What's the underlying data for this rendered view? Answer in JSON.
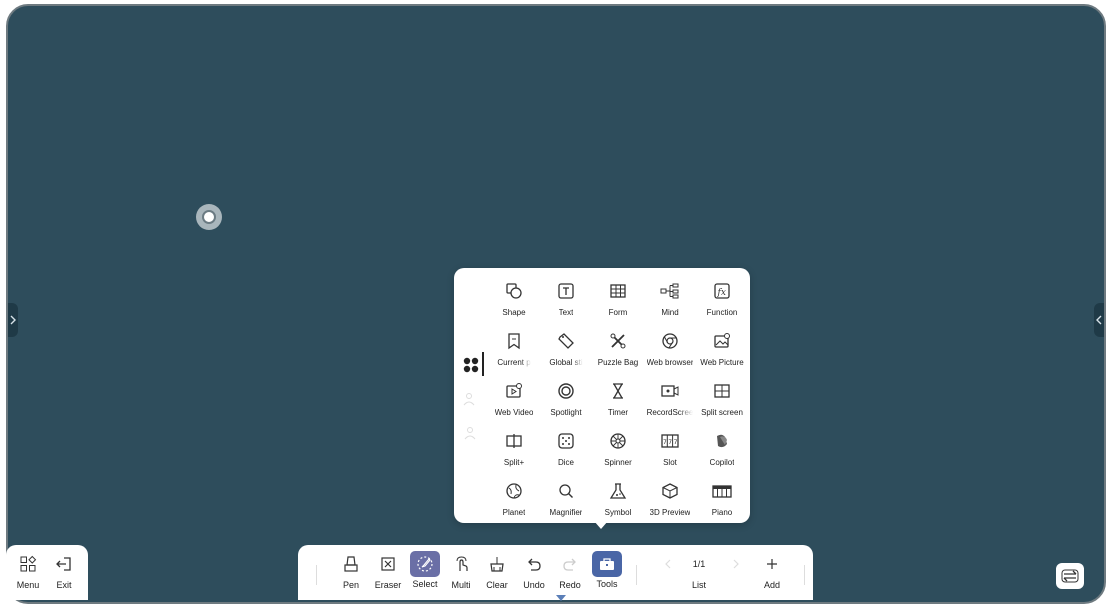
{
  "canvas": {
    "background": "#2e4d5c"
  },
  "popup": {
    "tools": [
      {
        "label": "Shape",
        "icon": "shape-icon"
      },
      {
        "label": "Text",
        "icon": "text-icon"
      },
      {
        "label": "Form",
        "icon": "form-icon"
      },
      {
        "label": "Mind",
        "icon": "mind-icon"
      },
      {
        "label": "Function",
        "icon": "function-icon"
      },
      {
        "label": "Current p",
        "icon": "current-page-icon"
      },
      {
        "label": "Global sti",
        "icon": "global-sticker-icon"
      },
      {
        "label": "Puzzle Bag",
        "icon": "puzzle-bag-icon"
      },
      {
        "label": "Web browser",
        "icon": "web-browser-icon"
      },
      {
        "label": "Web Picture",
        "icon": "web-picture-icon"
      },
      {
        "label": "Web Video",
        "icon": "web-video-icon"
      },
      {
        "label": "Spotlight",
        "icon": "spotlight-icon"
      },
      {
        "label": "Timer",
        "icon": "timer-icon"
      },
      {
        "label": "RecordScree",
        "icon": "record-screen-icon"
      },
      {
        "label": "Split screen",
        "icon": "split-screen-icon"
      },
      {
        "label": "Split+",
        "icon": "split-plus-icon"
      },
      {
        "label": "Dice",
        "icon": "dice-icon"
      },
      {
        "label": "Spinner",
        "icon": "spinner-icon"
      },
      {
        "label": "Slot",
        "icon": "slot-icon"
      },
      {
        "label": "Copilot",
        "icon": "copilot-icon"
      },
      {
        "label": "Planet",
        "icon": "planet-icon"
      },
      {
        "label": "Magnifier",
        "icon": "magnifier-icon"
      },
      {
        "label": "Symbol",
        "icon": "symbol-icon"
      },
      {
        "label": "3D Preview",
        "icon": "3d-preview-icon"
      },
      {
        "label": "Piano",
        "icon": "piano-icon"
      }
    ]
  },
  "left_bar": {
    "menu": "Menu",
    "exit": "Exit"
  },
  "toolbar": {
    "pen": "Pen",
    "eraser": "Eraser",
    "select": "Select",
    "multi": "Multi",
    "clear": "Clear",
    "undo": "Undo",
    "redo": "Redo",
    "tools": "Tools",
    "page": "1/1",
    "list": "List",
    "add": "Add",
    "select_color": "#6a6fa6",
    "tools_color": "#4a66a6"
  }
}
